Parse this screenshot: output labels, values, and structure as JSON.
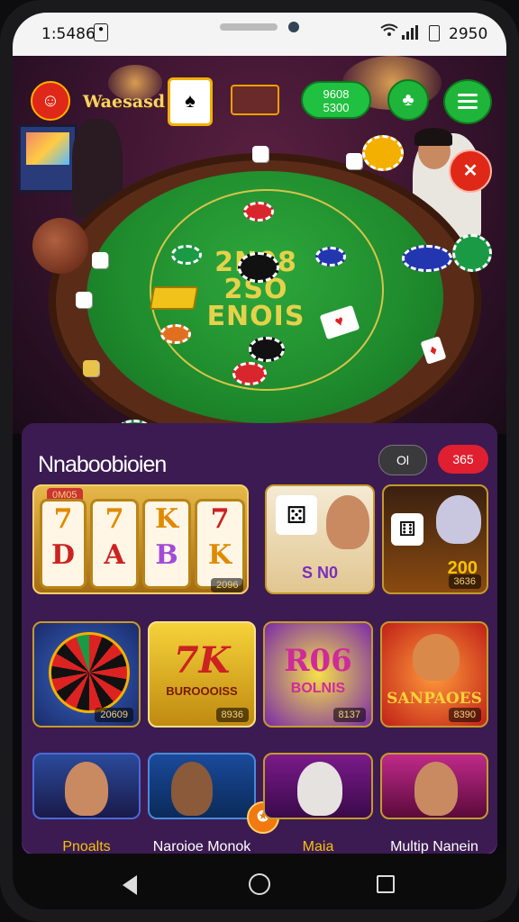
{
  "status_bar": {
    "time": "1:5486",
    "battery": "2950"
  },
  "hud": {
    "logo": "Waesasd",
    "balance_line1": "9608",
    "balance_line2": "5300",
    "colors": {
      "green": "#1fb53a",
      "red": "#e02030",
      "purple": "#3c1b52"
    }
  },
  "table": {
    "felt_text": [
      "2N08",
      "2SO",
      "ENOIS"
    ]
  },
  "lobby": {
    "title": "Nnaboobioien",
    "pill_left": "Ol",
    "pill_right": "365",
    "row1": {
      "slot_tag_top": "0M05",
      "slot_badge": "2096",
      "tile2_sub": "S N0",
      "tile3_label": "200",
      "tile3_badge": "3636"
    },
    "row2": [
      {
        "main": "",
        "badge": "20609"
      },
      {
        "main": "7K",
        "sub": "BUROOOISS",
        "badge": "8936"
      },
      {
        "main": "R06",
        "sub": "BOLNIS",
        "badge": "8137"
      },
      {
        "main": "",
        "sub": "SANPAOES",
        "badge": "8390"
      }
    ],
    "captions": [
      "Pnoalts",
      "Naroioe Monok",
      "Maia",
      "Multip Nanein"
    ]
  },
  "icons": [
    "back-icon",
    "home-icon",
    "recent-apps-icon",
    "wifi-icon",
    "menu-icon",
    "close-icon"
  ]
}
